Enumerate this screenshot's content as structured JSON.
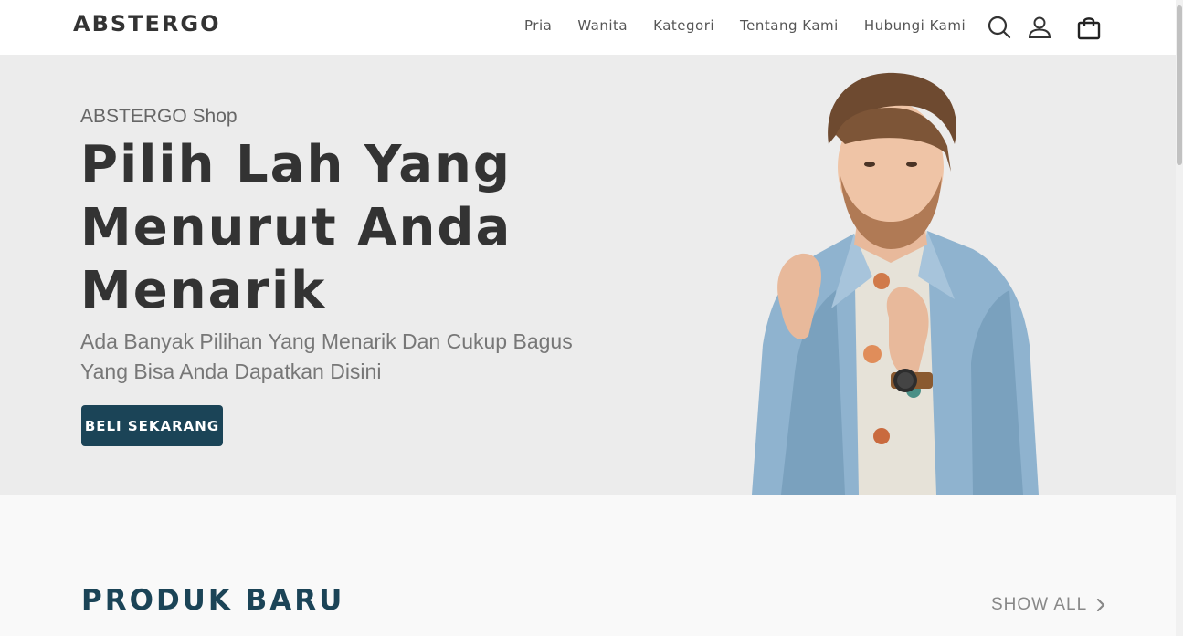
{
  "header": {
    "brand": "ABSTERGO",
    "nav": [
      "Pria",
      "Wanita",
      "Kategori",
      "Tentang Kami",
      "Hubungi Kami"
    ],
    "icons": [
      "search-icon",
      "user-icon",
      "shopping-bag-icon"
    ]
  },
  "hero": {
    "kicker": "ABSTERGO Shop",
    "title": "Pilih Lah Yang Menurut Anda Menarik",
    "subtitle": "Ada Banyak Pilihan Yang Menarik Dan Cukup Bagus Yang Bisa Anda Dapatkan Disini",
    "cta": "BELI SEKARANG"
  },
  "products": {
    "title": "PRODUK BARU",
    "show_all": "SHOW ALL"
  },
  "colors": {
    "primary": "#1b4457",
    "hero_bg": "#ececec",
    "text_dark": "#333333",
    "text_muted": "#777777"
  }
}
